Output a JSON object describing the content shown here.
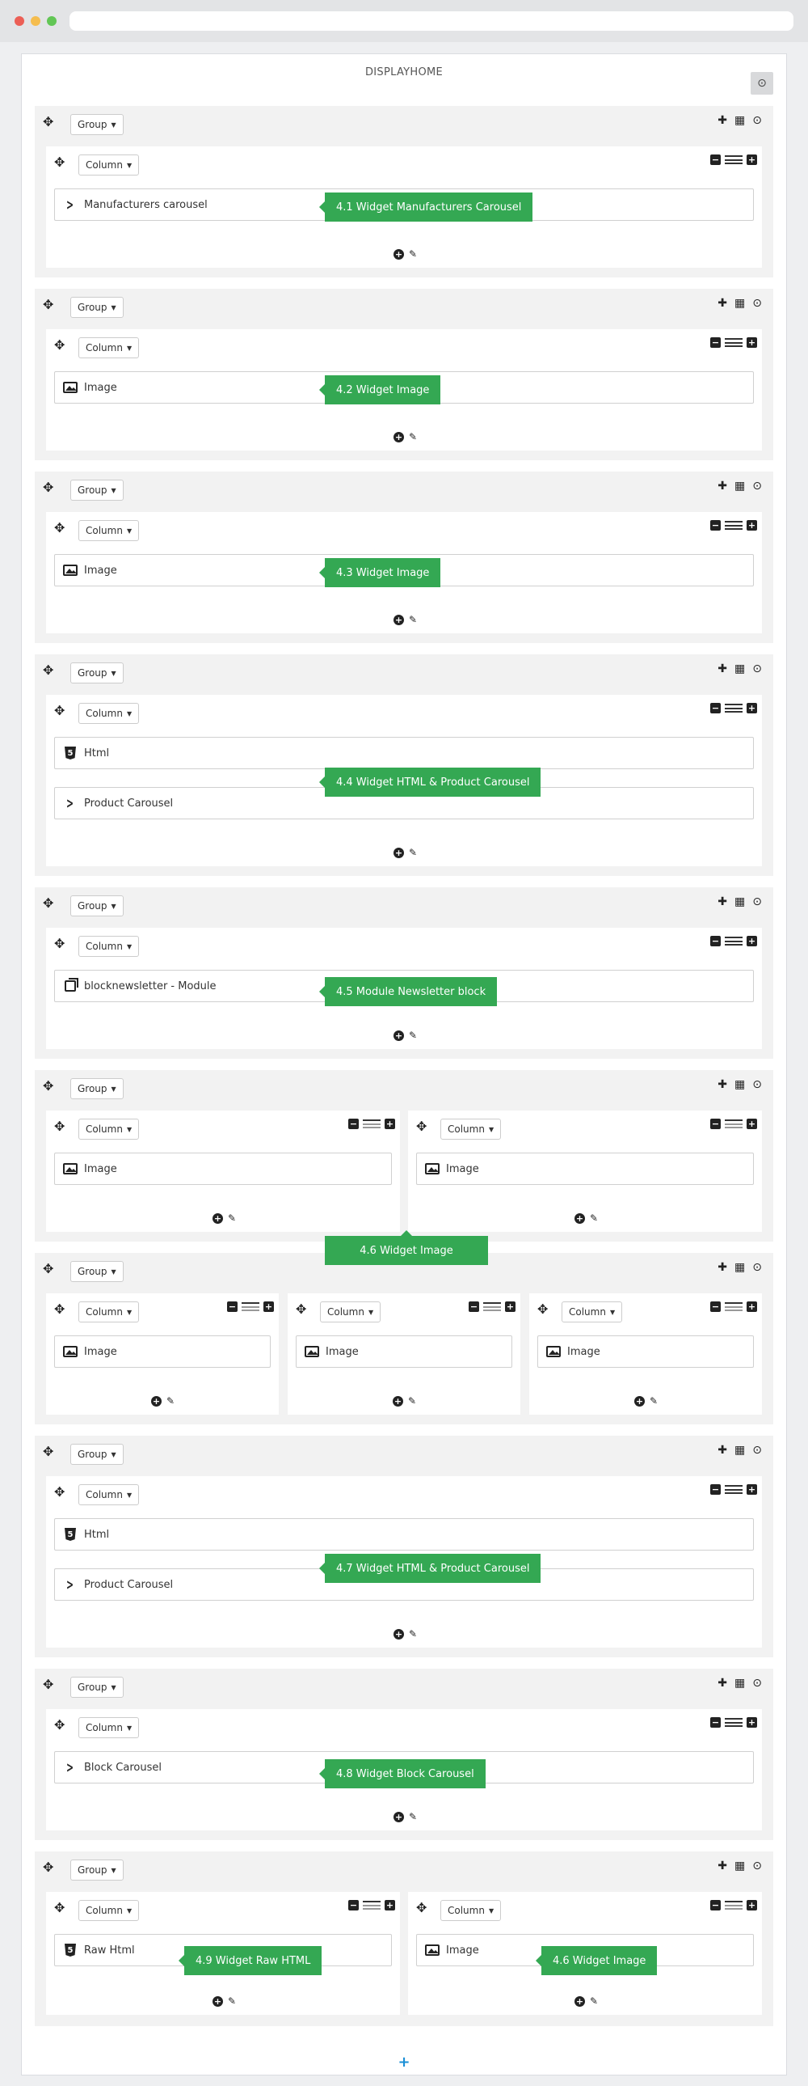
{
  "panel_title": "DISPLAYHOME",
  "group_label": "Group",
  "column_label": "Column",
  "add_symbol": "+",
  "widgets": {
    "manufacturers_carousel": "Manufacturers carousel",
    "image": "Image",
    "html": "Html",
    "product_carousel": "Product Carousel",
    "newsletter_module": "blocknewsletter - Module",
    "block_carousel": "Block Carousel",
    "raw_html": "Raw Html"
  },
  "callouts": {
    "c41": "4.1 Widget Manufacturers Carousel",
    "c42": "4.2 Widget Image",
    "c43": "4.3 Widget Image",
    "c44": "4.4 Widget HTML & Product Carousel",
    "c45": "4.5 Module Newsletter block",
    "c46": "4.6 Widget Image",
    "c47": "4.7 Widget HTML & Product Carousel",
    "c48": "4.8 Widget Block Carousel",
    "c49": "4.9 Widget Raw HTML",
    "c46b": "4.6 Widget Image"
  },
  "icons": [
    "move-icon",
    "caret-down-icon",
    "plus-icon",
    "grid-icon",
    "circle-arrow-icon",
    "minus-icon",
    "bars-icon",
    "image-icon",
    "html5-icon",
    "chevron-right-icon",
    "module-icon",
    "pencil-icon",
    "plus-circle-icon"
  ]
}
